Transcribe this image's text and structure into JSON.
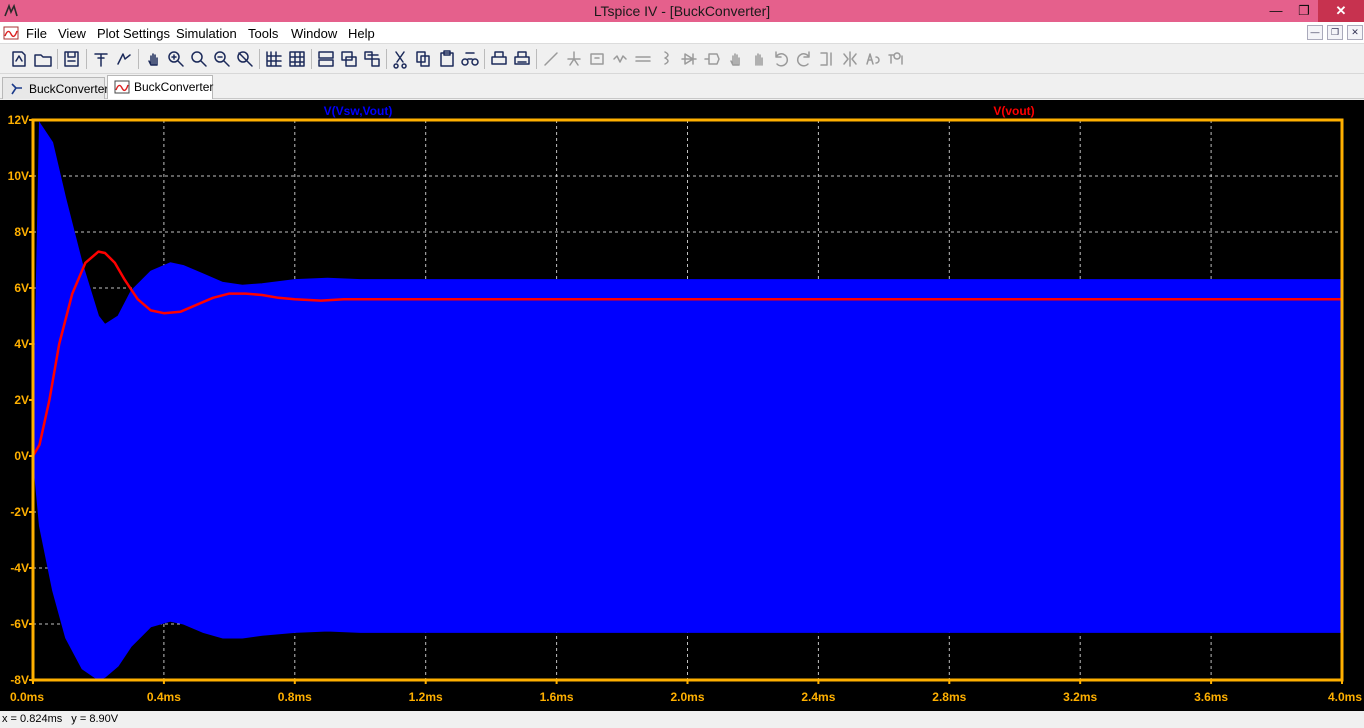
{
  "window": {
    "title": "LTspice IV - [BuckConverter]",
    "controls": [
      "minimize-icon",
      "restore-icon",
      "close-icon"
    ],
    "close_glyph": "✕",
    "minimize_glyph": "—",
    "restore_glyph": "❐"
  },
  "menu": {
    "items": [
      "File",
      "View",
      "Plot Settings",
      "Simulation",
      "Tools",
      "Window",
      "Help"
    ]
  },
  "toolbar": {
    "icons": [
      "new-schematic-icon",
      "open-icon",
      "save-icon",
      "control-panel-icon",
      "run-icon",
      "pan-icon",
      "zoom-in-icon",
      "zoom-area-icon",
      "zoom-out-icon",
      "zoom-fit-icon",
      "autorange-icon",
      "grid-icon",
      "tile-horizontal-icon",
      "cascade-icon",
      "tile-icon",
      "cut-icon",
      "copy-icon",
      "paste-icon",
      "find-icon",
      "print-preview-icon",
      "print-icon",
      "wire-icon",
      "ground-icon",
      "label-icon",
      "resistor-icon",
      "capacitor-icon",
      "inductor-icon",
      "diode-icon",
      "component-icon",
      "move-icon",
      "drag-icon",
      "undo-icon",
      "redo-icon",
      "rotate-icon",
      "mirror-icon",
      "text-icon",
      "spice-directive-icon"
    ]
  },
  "tabs": [
    {
      "label": "BuckConverter",
      "icon": "schematic-icon",
      "active": false
    },
    {
      "label": "BuckConverter",
      "icon": "waveform-icon",
      "active": true
    }
  ],
  "plot": {
    "traces": [
      {
        "label": "V(Vsw,Vout)",
        "color": "#0000ff"
      },
      {
        "label": "V(vout)",
        "color": "#ff0000"
      }
    ],
    "y_ticks": [
      "12V",
      "10V",
      "8V",
      "6V",
      "4V",
      "2V",
      "0V",
      "-2V",
      "-4V",
      "-6V",
      "-8V"
    ],
    "x_ticks": [
      "0.0ms",
      "0.4ms",
      "0.8ms",
      "1.2ms",
      "1.6ms",
      "2.0ms",
      "2.4ms",
      "2.8ms",
      "3.2ms",
      "3.6ms",
      "4.0ms"
    ],
    "axis_color": "#ffb000",
    "grid_color": "#ffffff",
    "background": "#000000"
  },
  "chart_data": {
    "type": "line",
    "xlim": [
      0,
      4.0
    ],
    "ylim": [
      -8,
      12
    ],
    "xlabel": "",
    "ylabel": "",
    "title": "",
    "grid": true,
    "series": [
      {
        "name": "V(Vsw,Vout)",
        "kind": "envelope",
        "color": "#0000ff",
        "x": [
          0,
          0.02,
          0.06,
          0.1,
          0.15,
          0.2,
          0.22,
          0.26,
          0.3,
          0.36,
          0.42,
          0.46,
          0.52,
          0.58,
          0.64,
          0.7,
          0.8,
          0.9,
          1.0,
          1.2,
          1.6,
          2.0,
          4.0
        ],
        "upper": [
          0,
          11.9,
          11.2,
          9.2,
          6.9,
          5.0,
          4.7,
          5.0,
          5.9,
          6.6,
          6.9,
          6.8,
          6.5,
          6.2,
          6.1,
          6.15,
          6.3,
          6.35,
          6.3,
          6.3,
          6.3,
          6.3,
          6.3
        ],
        "lower": [
          0,
          -2.5,
          -4.8,
          -6.5,
          -7.6,
          -8.0,
          -7.9,
          -7.5,
          -6.8,
          -6.1,
          -5.9,
          -6.0,
          -6.3,
          -6.5,
          -6.5,
          -6.4,
          -6.3,
          -6.25,
          -6.3,
          -6.3,
          -6.3,
          -6.3,
          -6.3
        ]
      },
      {
        "name": "V(vout)",
        "kind": "line",
        "color": "#ff0000",
        "x": [
          0,
          0.02,
          0.05,
          0.08,
          0.12,
          0.16,
          0.2,
          0.22,
          0.25,
          0.28,
          0.32,
          0.36,
          0.4,
          0.45,
          0.5,
          0.55,
          0.6,
          0.65,
          0.7,
          0.75,
          0.8,
          0.88,
          0.95,
          1.05,
          1.2,
          1.6,
          2.0,
          4.0
        ],
        "values": [
          0,
          0.4,
          2.0,
          4.0,
          5.8,
          6.9,
          7.3,
          7.25,
          6.9,
          6.3,
          5.6,
          5.2,
          5.1,
          5.15,
          5.4,
          5.65,
          5.8,
          5.8,
          5.75,
          5.65,
          5.6,
          5.55,
          5.6,
          5.6,
          5.6,
          5.6,
          5.6,
          5.6
        ]
      }
    ]
  },
  "status": {
    "x_readout": "x = 0.824ms",
    "y_readout": "y = 8.90V"
  }
}
